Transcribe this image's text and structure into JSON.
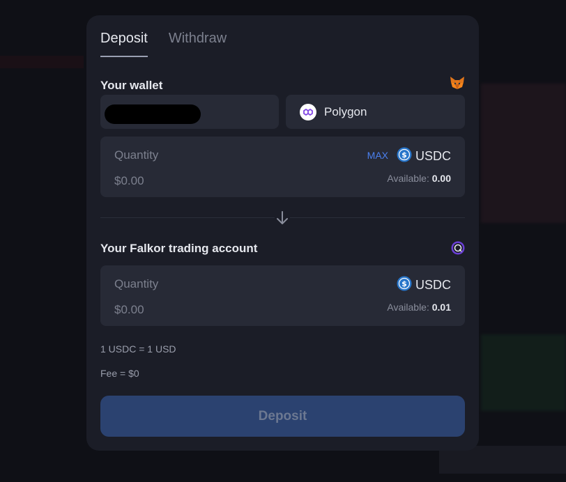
{
  "tabs": {
    "deposit": "Deposit",
    "withdraw": "Withdraw"
  },
  "wallet": {
    "title": "Your wallet",
    "provider_icon": "metamask-fox-icon",
    "network": "Polygon"
  },
  "source": {
    "quantity_label": "Quantity",
    "amount": "$0.00",
    "max_label": "MAX",
    "token": "USDC",
    "available_label": "Available:",
    "available_value": "0.00"
  },
  "destination": {
    "title": "Your Falkor trading account",
    "quantity_label": "Quantity",
    "amount": "$0.00",
    "token": "USDC",
    "available_label": "Available:",
    "available_value": "0.01"
  },
  "rate": "1 USDC = 1 USD",
  "fee": "Fee = $0",
  "submit_label": "Deposit",
  "colors": {
    "accent": "#4b80ef",
    "button_bg": "#2b4270",
    "panel": "#1b1d27",
    "field": "#272a36"
  }
}
